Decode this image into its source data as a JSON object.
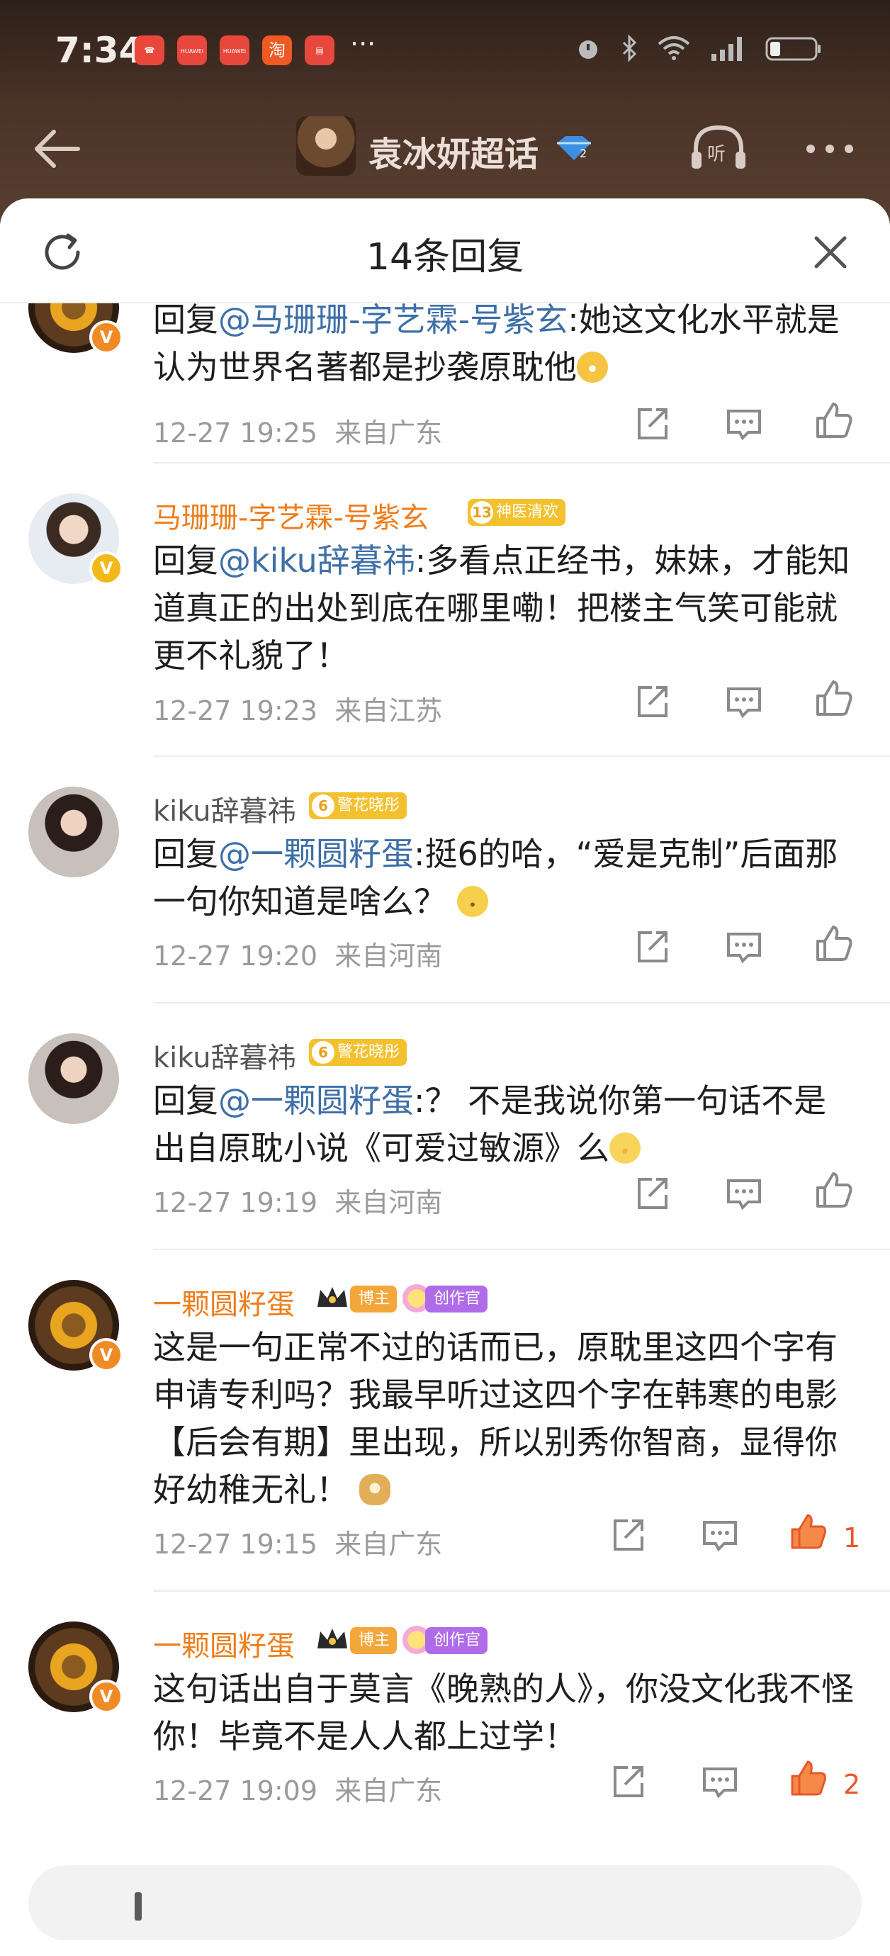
{
  "status": {
    "time": "7:34",
    "app_icons": [
      {
        "name": "missed-call-icon",
        "label": "",
        "color": "#e8473b"
      },
      {
        "name": "huawei-icon",
        "label": "HUAWEI",
        "color": "#e8473b"
      },
      {
        "name": "huawei-icon-2",
        "label": "HUAWEI",
        "color": "#e8473b"
      },
      {
        "name": "taobao-icon",
        "label": "淘",
        "color": "#ee5a24"
      },
      {
        "name": "book-icon",
        "label": "",
        "color": "#e8473b"
      }
    ],
    "more": "···"
  },
  "topnav": {
    "title": "袁冰妍超话"
  },
  "sheet": {
    "title": "14条回复"
  },
  "comments": [
    {
      "text_prefix": "回复",
      "mention": "@马珊珊-字艺霖-号紫玄",
      "text": ":她这文化水平就是认为世界名著都是抄袭原耽他",
      "time": "12-27 19:25",
      "location": "来自广东"
    },
    {
      "user": "马珊珊-字艺霖-号紫玄",
      "badge_level": "13",
      "badge_label": "神医清欢",
      "text_prefix": "回复",
      "mention": "@kiku辞暮祎",
      "text": ":多看点正经书，妹妹，才能知道真正的出处到底在哪里嘞！把楼主气笑可能就更不礼貌了！",
      "time": "12-27 19:23",
      "location": "来自江苏"
    },
    {
      "user": "kiku辞暮祎",
      "badge_level": "6",
      "badge_label": "警花晓彤",
      "text_prefix": "回复",
      "mention": "@一颗圆籽蛋",
      "text": ":挺6的哈，“爱是克制”后面那一句你知道是啥么？",
      "time": "12-27 19:20",
      "location": "来自河南"
    },
    {
      "user": "kiku辞暮祎",
      "badge_level": "6",
      "badge_label": "警花晓彤",
      "text_prefix": "回复",
      "mention": "@一颗圆籽蛋",
      "text": ":？ 不是我说你第一句话不是出自原耽小说《可爱过敏源》么",
      "time": "12-27 19:19",
      "location": "来自河南"
    },
    {
      "user": "一颗圆籽蛋",
      "host_label": "博主",
      "creator_label": "创作官",
      "text": "这是一句正常不过的话而已，原耽里这四个字有申请专利吗？我最早听过这四个字在韩寒的电影【后会有期】里出现，所以别秀你智商，显得你好幼稚无礼！",
      "time": "12-27 19:15",
      "location": "来自广东",
      "likes": "1"
    },
    {
      "user": "一颗圆籽蛋",
      "host_label": "博主",
      "creator_label": "创作官",
      "text": "这句话出自于莫言《晚熟的人》，你没文化我不怪你！毕竟不是人人都上过学！",
      "time": "12-27 19:09",
      "location": "来自广东",
      "likes": "2"
    }
  ],
  "icons": {
    "verified": "V"
  }
}
